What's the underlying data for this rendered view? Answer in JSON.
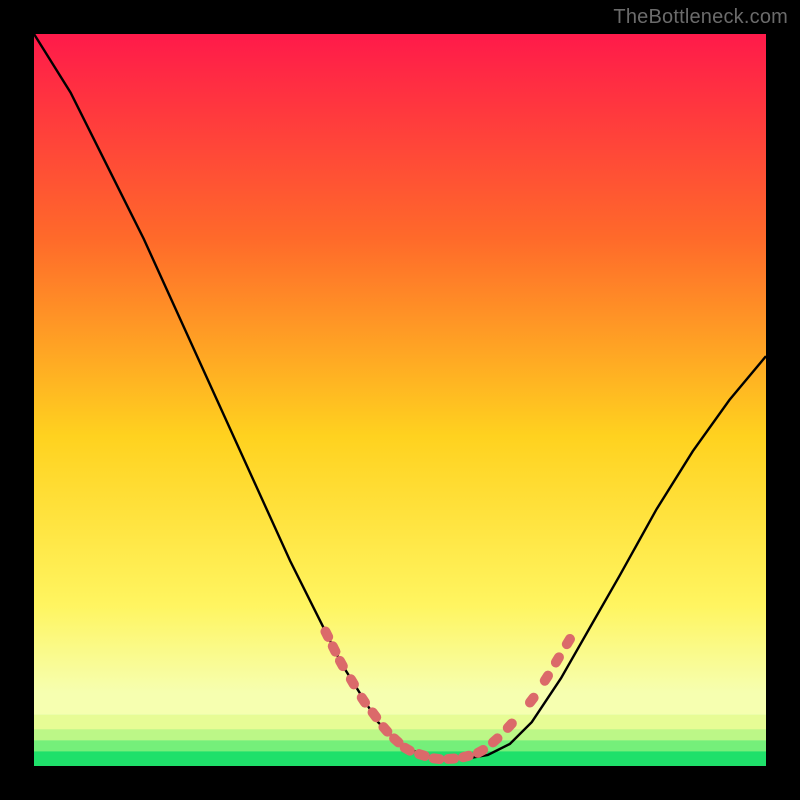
{
  "watermark": "TheBottleneck.com",
  "colors": {
    "background": "#000000",
    "gradient_top": "#ff1a4a",
    "gradient_mid1": "#ff6a2a",
    "gradient_mid2": "#ffd21f",
    "gradient_mid3": "#fff560",
    "gradient_low_pale": "#f6ffb0",
    "gradient_green": "#1fe06a",
    "curve_stroke": "#000000",
    "marker": "#db6a6a",
    "watermark": "#6b6b6b"
  },
  "chart_data": {
    "type": "line",
    "title": "",
    "xlabel": "",
    "ylabel": "",
    "xlim": [
      0,
      100
    ],
    "ylim": [
      0,
      100
    ],
    "series": [
      {
        "name": "bottleneck-curve",
        "x": [
          0,
          5,
          10,
          15,
          20,
          25,
          30,
          35,
          40,
          42,
          47,
          50,
          53,
          56,
          59,
          62,
          65,
          68,
          72,
          76,
          80,
          85,
          90,
          95,
          100
        ],
        "y": [
          100,
          92,
          82,
          72,
          61,
          50,
          39,
          28,
          18,
          14,
          6,
          3,
          1.5,
          1,
          1,
          1.5,
          3,
          6,
          12,
          19,
          26,
          35,
          43,
          50,
          56
        ]
      }
    ],
    "markers": {
      "name": "highlighted-segments",
      "points": [
        {
          "x": 40,
          "y": 18
        },
        {
          "x": 41,
          "y": 16
        },
        {
          "x": 42,
          "y": 14
        },
        {
          "x": 43.5,
          "y": 11.5
        },
        {
          "x": 45,
          "y": 9
        },
        {
          "x": 46.5,
          "y": 7
        },
        {
          "x": 48,
          "y": 5
        },
        {
          "x": 49.5,
          "y": 3.5
        },
        {
          "x": 51,
          "y": 2.3
        },
        {
          "x": 53,
          "y": 1.5
        },
        {
          "x": 55,
          "y": 1
        },
        {
          "x": 57,
          "y": 1
        },
        {
          "x": 59,
          "y": 1.3
        },
        {
          "x": 61,
          "y": 2
        },
        {
          "x": 63,
          "y": 3.5
        },
        {
          "x": 65,
          "y": 5.5
        },
        {
          "x": 68,
          "y": 9
        },
        {
          "x": 70,
          "y": 12
        },
        {
          "x": 71.5,
          "y": 14.5
        },
        {
          "x": 73,
          "y": 17
        }
      ]
    },
    "bottom_bands": [
      {
        "y0": 0,
        "y1": 2,
        "color": "#1fe06a"
      },
      {
        "y0": 2,
        "y1": 3.5,
        "color": "#75ef7a"
      },
      {
        "y0": 3.5,
        "y1": 5,
        "color": "#bcf787"
      },
      {
        "y0": 5,
        "y1": 7,
        "color": "#e7fc95"
      },
      {
        "y0": 7,
        "y1": 10,
        "color": "#f6ffb0"
      }
    ]
  }
}
